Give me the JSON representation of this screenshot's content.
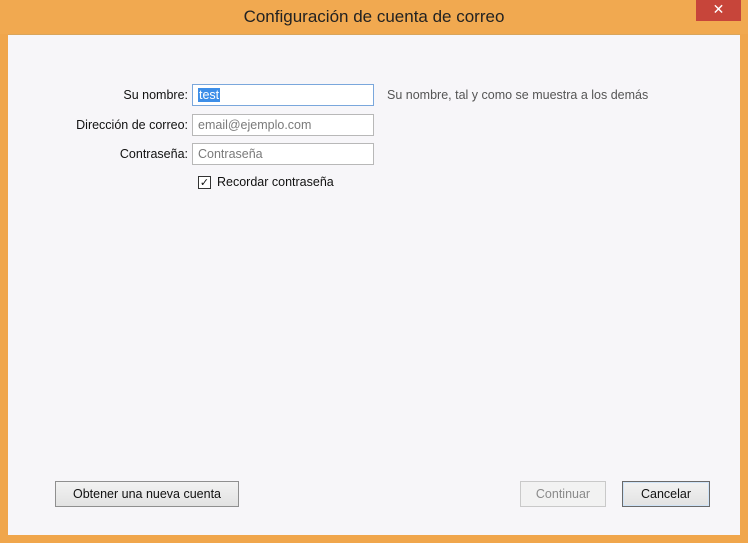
{
  "window": {
    "title": "Configuración de cuenta de correo",
    "close_glyph": "✕"
  },
  "form": {
    "name": {
      "label": "Su nombre:",
      "value": "test",
      "hint": "Su nombre, tal y como se muestra a los demás"
    },
    "email": {
      "label": "Dirección de correo:",
      "placeholder": "email@ejemplo.com"
    },
    "password": {
      "label": "Contraseña:",
      "placeholder": "Contraseña"
    },
    "remember": {
      "label": "Recordar contraseña",
      "checked": true,
      "check_glyph": "✓"
    }
  },
  "buttons": {
    "new_account": "Obtener una nueva cuenta",
    "continue": "Continuar",
    "cancel": "Cancelar"
  },
  "colors": {
    "titlebar": "#f1a950",
    "close_button": "#c7453a",
    "selection": "#3d8ee8"
  }
}
